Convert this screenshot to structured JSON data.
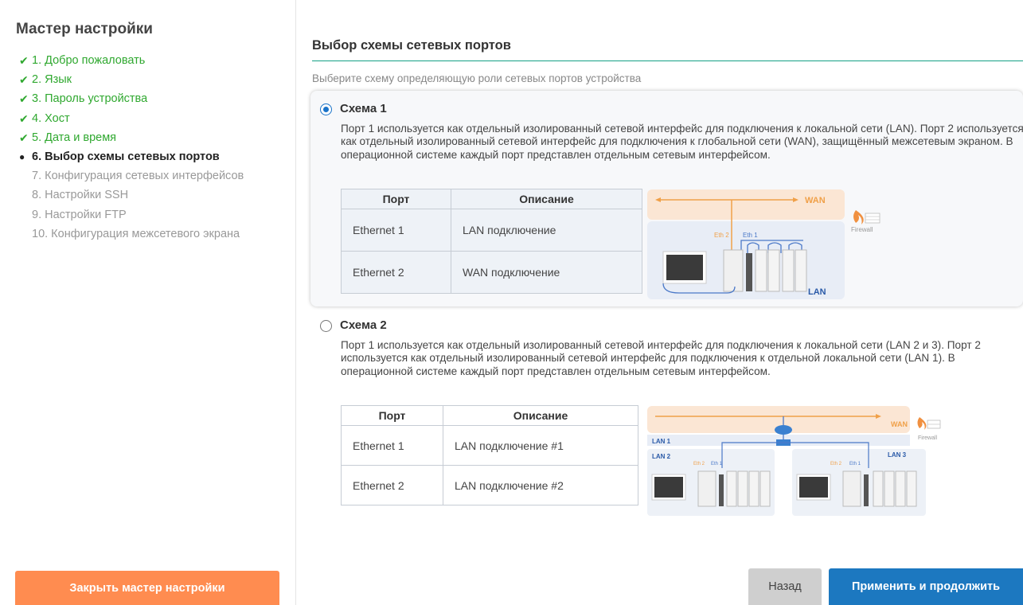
{
  "sidebar": {
    "title": "Мастер настройки",
    "steps": [
      {
        "label": "1. Добро пожаловать",
        "mark": "✔"
      },
      {
        "label": "2. Язык",
        "mark": "✔"
      },
      {
        "label": "3. Пароль устройства",
        "mark": "✔"
      },
      {
        "label": "4. Хост",
        "mark": "✔"
      },
      {
        "label": "5. Дата и время",
        "mark": "✔"
      },
      {
        "label": "6. Выбор схемы сетевых портов",
        "mark": "●"
      },
      {
        "label": "7. Конфигурация сетевых интерфейсов",
        "mark": ""
      },
      {
        "label": "8. Настройки SSH",
        "mark": ""
      },
      {
        "label": "9. Настройки FTP",
        "mark": ""
      },
      {
        "label": "10. Конфигурация межсетевого экрана",
        "mark": ""
      }
    ],
    "close_button": "Закрыть мастер настройки"
  },
  "main": {
    "title": "Выбор схемы сетевых портов",
    "subtitle": "Выберите схему определяющую роли сетевых портов устройства",
    "schemes": [
      {
        "name": "Схема 1",
        "selected": true,
        "description": "Порт 1 используется как отдельный изолированный сетевой интерфейс для подключения к локальной сети (LAN). Порт 2 используется как отдельный изолированный сетевой интерфейс для подключения к глобальной сети (WAN), защищённый межсетевым экраном. В операционной системе каждый порт представлен отдельным сетевым интерфейсом.",
        "table": {
          "headers": [
            "Порт",
            "Описание"
          ],
          "rows": [
            [
              "Ethernet 1",
              "LAN подключение"
            ],
            [
              "Ethernet 2",
              "WAN подключение"
            ]
          ]
        },
        "diagram": {
          "wan": "WAN",
          "lan": "LAN",
          "eth2": "Eth 2",
          "eth1": "Eth 1",
          "firewall": "Firewall"
        }
      },
      {
        "name": "Схема 2",
        "selected": false,
        "description": "Порт 1 используется как отдельный изолированный сетевой интерфейс для подключения к локальной сети (LAN 2 и 3). Порт 2 используется как отдельный изолированный сетевой интерфейс для подключения к отдельной локальной сети (LAN 1). В операционной системе каждый порт представлен отдельным сетевым интерфейсом.",
        "table": {
          "headers": [
            "Порт",
            "Описание"
          ],
          "rows": [
            [
              "Ethernet 1",
              "LAN подключение #1"
            ],
            [
              "Ethernet 2",
              "LAN подключение #2"
            ]
          ]
        },
        "diagram": {
          "wan": "WAN",
          "lan1": "LAN 1",
          "lan2": "LAN 2",
          "lan3": "LAN 3",
          "eth2": "Eth 2",
          "eth1": "Eth 1",
          "firewall": "Firewall"
        }
      }
    ]
  },
  "footer": {
    "back_button": "Назад",
    "apply_button": "Применить и продолжить"
  },
  "colors": {
    "done": "#2fa82f",
    "accent_line": "#14a085",
    "primary": "#1c78c0",
    "close_button": "#ff8c50",
    "wan_orange": "#f0a048"
  }
}
